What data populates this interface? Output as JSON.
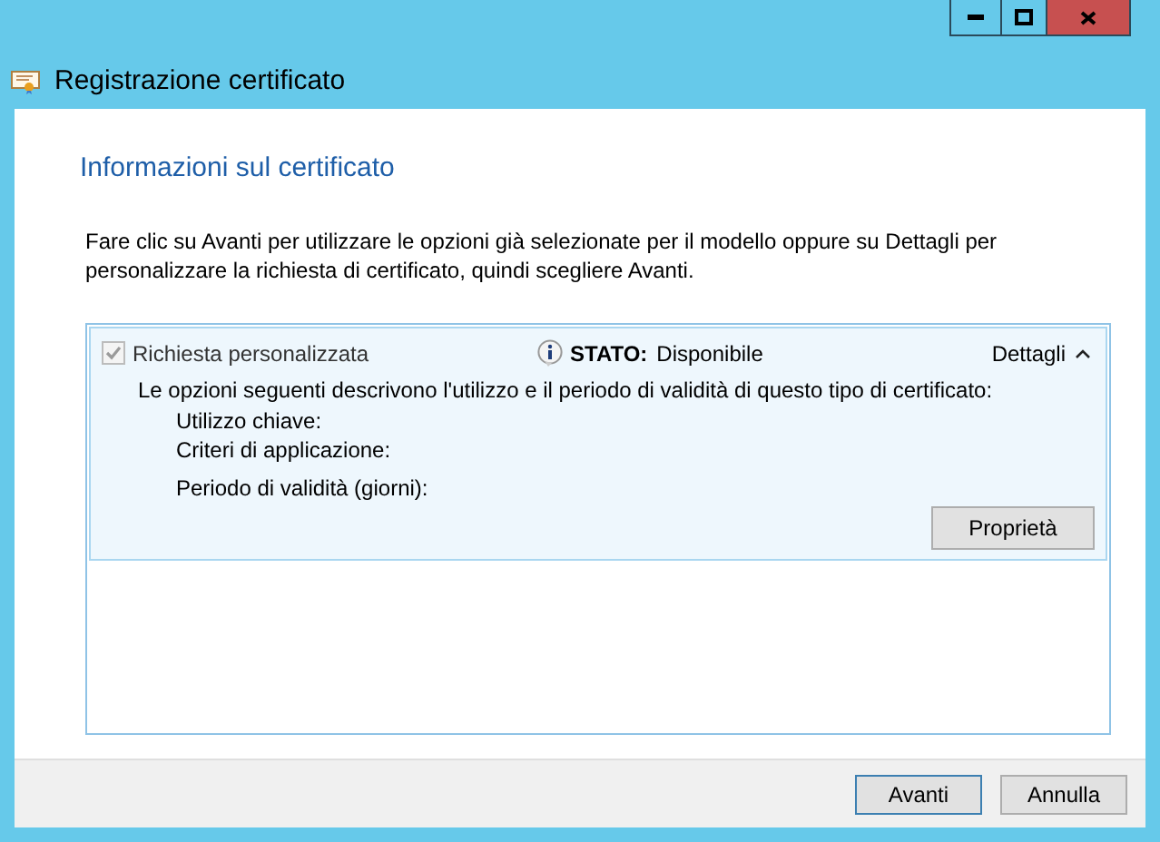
{
  "window": {
    "title": "Registrazione certificato"
  },
  "heading": "Informazioni sul certificato",
  "intro": "Fare clic su Avanti per utilizzare le opzioni già selezionate per il modello oppure su Dettagli per personalizzare la richiesta di certificato, quindi scegliere Avanti.",
  "requests": [
    {
      "label": "Richiesta personalizzata",
      "checked": true,
      "disabled": true,
      "status_label": "STATO:",
      "status_value": "Disponibile",
      "details_label": "Dettagli",
      "expanded": true,
      "description": "Le opzioni seguenti descrivono l'utilizzo e il periodo di validità di questo tipo di certificato:",
      "properties": [
        "Utilizzo chiave:",
        "Criteri di applicazione:",
        "Periodo di validità (giorni):"
      ],
      "button": "Proprietà"
    }
  ],
  "buttons": [
    {
      "label": "Avanti",
      "default": true
    },
    {
      "label": "Annulla",
      "default": false
    }
  ]
}
